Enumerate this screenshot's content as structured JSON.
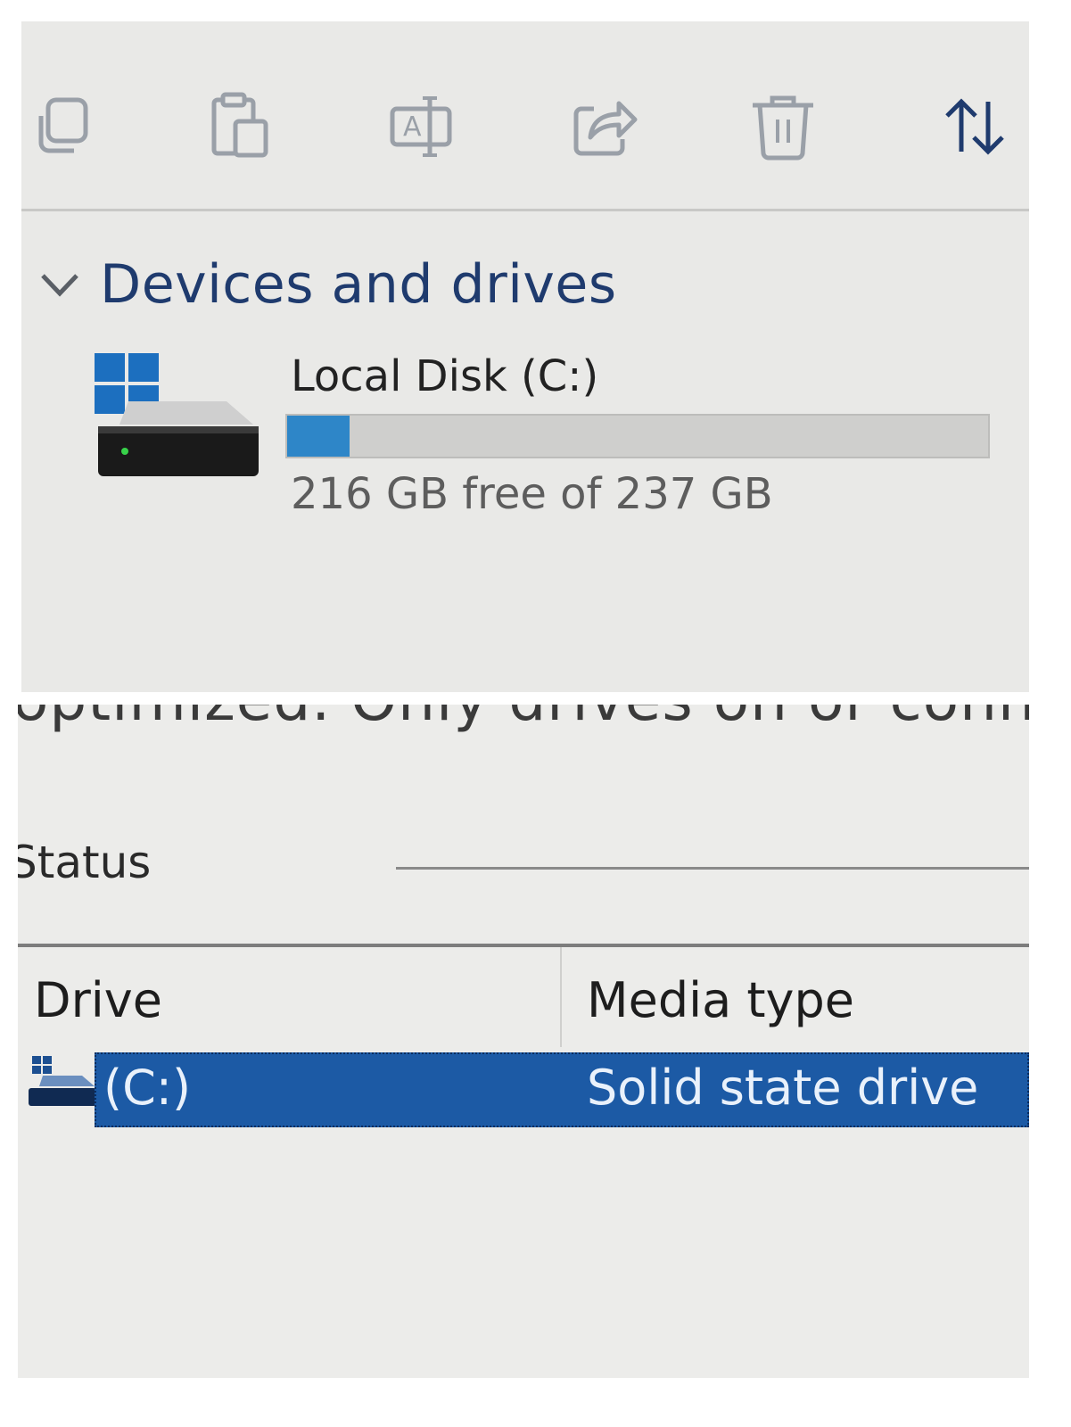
{
  "toolbar": {
    "buttons": [
      {
        "icon": "copy-icon"
      },
      {
        "icon": "paste-icon"
      },
      {
        "icon": "rename-icon"
      },
      {
        "icon": "share-icon"
      },
      {
        "icon": "delete-icon"
      },
      {
        "icon": "sort-icon"
      }
    ]
  },
  "devices": {
    "section_title": "Devices and drives",
    "drive": {
      "name": "Local Disk (C:)",
      "space_text": "216 GB free of 237 GB",
      "used_fraction": 0.089
    }
  },
  "optimize": {
    "cut_text": "optimized. Only drives on or connected to your",
    "status_label": "Status",
    "columns": {
      "drive": "Drive",
      "media_type": "Media type"
    },
    "rows": [
      {
        "drive": "(C:)",
        "media_type": "Solid state drive"
      }
    ]
  },
  "colors": {
    "accent": "#2e86c8",
    "selection": "#1c5aa5",
    "windows_logo": "#1c6fbf"
  }
}
